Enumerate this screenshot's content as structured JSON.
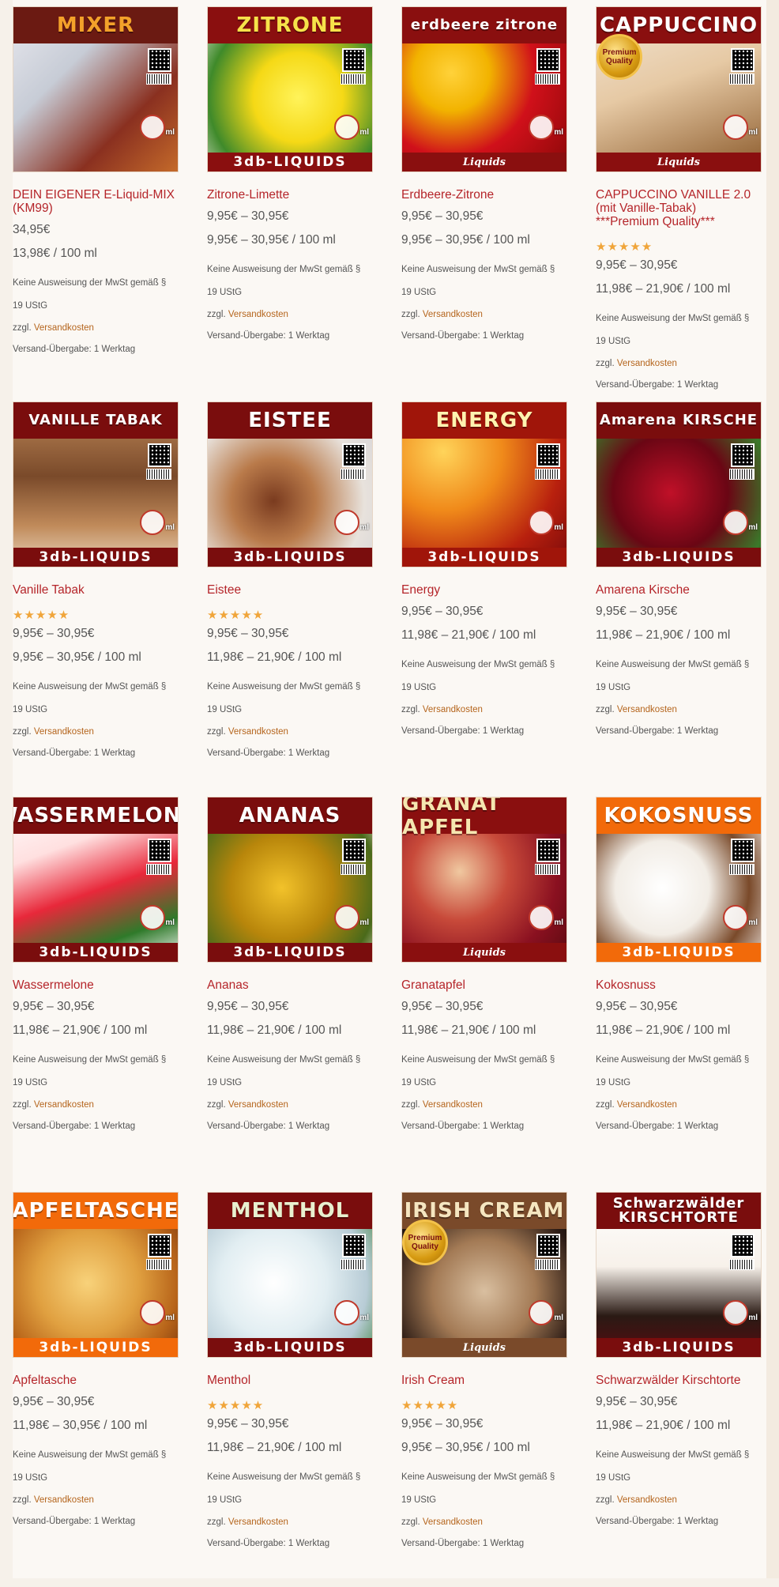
{
  "colors": {
    "accent": "#b5252a",
    "link": "#b5651d",
    "stars": "#f0a53a"
  },
  "labels": {
    "tax_note": "Keine Ausweisung der MwSt gemäß §",
    "tax_note_2": "19 UStG",
    "shipping_prefix": "zzgl.",
    "shipping_link": "Versandkosten",
    "delivery": "Versand-Übergabe: 1 Werktag",
    "brand": "3db-LIQUIDS",
    "ml": "ml"
  },
  "products": [
    {
      "name": "DEIN EIGENER E-Liquid-MIX (KM99)",
      "price": "34,95€",
      "unit_price": "13,98€ / 100 ml",
      "rating": 0,
      "rating_shown": false,
      "banner": "MIXER",
      "banner_color": "#6b1a12",
      "img": "linear-gradient(135deg,#e8e8ee 0%,#c7ccd6 35%,#8a3020 70%,#c46a2a 100%)",
      "banner_text_color": "#f3a12a",
      "bottom": "",
      "medal": ""
    },
    {
      "name": "Zitrone-Limette",
      "price": "9,95€ – 30,95€",
      "unit_price": "9,95€ – 30,95€ / 100 ml",
      "rating": 0,
      "rating_shown": false,
      "banner": "ZITRONE",
      "banner_color": "#8a0f0f",
      "img": "radial-gradient(circle at 55% 55%,#fff35a 0%,#f5d916 35%,#3f8a2a 70%,#e9e9e0 100%)",
      "banner_text_color": "#f6e24a",
      "bottom": "3db-LIQUIDS",
      "medal": ""
    },
    {
      "name": "Erdbeere-Zitrone",
      "price": "9,95€ – 30,95€",
      "unit_price": "9,95€ – 30,95€ / 100 ml",
      "rating": 0,
      "rating_shown": false,
      "banner": "erdbeere zitrone",
      "banner_color": "#8a0f0f",
      "img": "radial-gradient(circle at 30% 40%,#ffd23a 0%,#f2b300 25%,#d0101a 55%,#8a0808 100%)",
      "banner_text_color": "#ffffff",
      "bottom": "Liquids",
      "medal": ""
    },
    {
      "name": "CAPPUCCINO VANILLE 2.0 (mit Vanille-Tabak) ***Premium Quality***",
      "price": "9,95€ – 30,95€",
      "unit_price": "11,98€ – 21,90€ / 100 ml",
      "rating": 5,
      "rating_shown": true,
      "banner": "CAPPUCCINO",
      "banner_color": "#8a0f0f",
      "img": "linear-gradient(160deg,#f3e6d6 0%,#e6c9a4 45%,#8b5a2b 100%)",
      "banner_text_color": "#ffffff",
      "bottom": "Liquids",
      "medal": "Premium Quality"
    },
    {
      "name": "Vanille Tabak",
      "price": "9,95€ – 30,95€",
      "unit_price": "9,95€ – 30,95€ / 100 ml",
      "rating": 4.5,
      "rating_shown": true,
      "banner": "VANILLE TABAK",
      "banner_color": "#7a0d0d",
      "img": "linear-gradient(180deg,#c08a5a 0%,#7a4a2a 45%,#c08a5a 75%,#e8d4bc 100%)",
      "banner_text_color": "#ffffff",
      "bottom": "3db-LIQUIDS",
      "medal": ""
    },
    {
      "name": "Eistee",
      "price": "9,95€ – 30,95€",
      "unit_price": "11,98€ – 21,90€ / 100 ml",
      "rating": 5,
      "rating_shown": true,
      "banner": "EISTEE",
      "banner_color": "#7a0d0d",
      "img": "radial-gradient(circle at 40% 60%,#7a3b1f 0%,#b97a4a 30%,#e8e2dc 65%,#d0d0d6 100%)",
      "banner_text_color": "#ffffff",
      "bottom": "3db-LIQUIDS",
      "medal": ""
    },
    {
      "name": "Energy",
      "price": "9,95€ – 30,95€",
      "unit_price": "11,98€ – 21,90€ / 100 ml",
      "rating": 0,
      "rating_shown": false,
      "banner": "ENERGY",
      "banner_color": "#a0150a",
      "img": "radial-gradient(circle at 25% 30%,#ffd45a 0%,#f08a1a 35%,#b8200e 70%,#7a0a0a 100%)",
      "banner_text_color": "#fff3b0",
      "bottom": "3db-LIQUIDS",
      "medal": ""
    },
    {
      "name": "Amarena Kirsche",
      "price": "9,95€ – 30,95€",
      "unit_price": "11,98€ – 21,90€ / 100 ml",
      "rating": 0,
      "rating_shown": false,
      "banner": "Amarena KIRSCHE",
      "banner_color": "#7a0d0d",
      "img": "radial-gradient(circle at 45% 55%,#c01028 0%,#6a0614 45%,#3a7a2a 80%,#2a4a1a 100%)",
      "banner_text_color": "#ffffff",
      "bottom": "3db-LIQUIDS",
      "medal": ""
    },
    {
      "name": "Wassermelone",
      "price": "9,95€ – 30,95€",
      "unit_price": "11,98€ – 21,90€ / 100 ml",
      "rating": 0,
      "rating_shown": false,
      "banner": "WASSERMELONE",
      "banner_color": "#7a0d0d",
      "img": "linear-gradient(160deg,#ffffff 0%,#ffe0e0 30%,#e8283a 55%,#2f7a2a 80%,#ffffff 100%)",
      "banner_text_color": "#ffffff",
      "bottom": "3db-LIQUIDS",
      "medal": ""
    },
    {
      "name": "Ananas",
      "price": "9,95€ – 30,95€",
      "unit_price": "11,98€ – 21,90€ / 100 ml",
      "rating": 0,
      "rating_shown": false,
      "banner": "ANANAS",
      "banner_color": "#7a0d0d",
      "img": "radial-gradient(circle at 45% 55%,#f2c22a 0%,#b8860b 40%,#4a6a1a 75%,#f5f0e8 100%)",
      "banner_text_color": "#ffffff",
      "bottom": "3db-LIQUIDS",
      "medal": ""
    },
    {
      "name": "Granatapfel",
      "price": "9,95€ – 30,95€",
      "unit_price": "11,98€ – 21,90€ / 100 ml",
      "rating": 0,
      "rating_shown": false,
      "banner": "GRANAT APFEL",
      "banner_color": "#8a0f0f",
      "img": "radial-gradient(circle at 35% 45%,#f0c8a0 0%,#c84a3a 35%,#8a1020 70%,#5a0a10 100%)",
      "banner_text_color": "#f5e6b0",
      "bottom": "Liquids",
      "medal": ""
    },
    {
      "name": "Kokosnuss",
      "price": "9,95€ – 30,95€",
      "unit_price": "11,98€ – 21,90€ / 100 ml",
      "rating": 0,
      "rating_shown": false,
      "banner": "KOKOSNUSS",
      "banner_color": "#f26a0a",
      "img": "radial-gradient(circle at 40% 55%,#ffffff 0%,#f2ede6 35%,#7a4a2a 65%,#ffffff 100%)",
      "banner_text_color": "#ffffff",
      "bottom": "3db-LIQUIDS",
      "medal": ""
    },
    {
      "name": "Apfeltasche",
      "price": "9,95€ – 30,95€",
      "unit_price": "11,98€ – 30,95€ / 100 ml",
      "rating": 0,
      "rating_shown": false,
      "banner": "APFELTASCHE",
      "banner_color": "#f26a0a",
      "img": "radial-gradient(circle at 45% 55%,#f8d27a 0%,#e0a040 40%,#b8651a 70%,#6a2a0a 100%)",
      "banner_text_color": "#ffffff",
      "bottom": "3db-LIQUIDS",
      "medal": ""
    },
    {
      "name": "Menthol",
      "price": "9,95€ – 30,95€",
      "unit_price": "11,98€ – 21,90€ / 100 ml",
      "rating": 5,
      "rating_shown": true,
      "banner": "MENTHOL",
      "banner_color": "#7a0d0d",
      "img": "radial-gradient(circle at 40% 55%,#ffffff 0%,#e2eef2 40%,#b8ccd6 70%,#2f7a2a 100%)",
      "banner_text_color": "#e8f0d0",
      "bottom": "3db-LIQUIDS",
      "medal": ""
    },
    {
      "name": "Irish Cream",
      "price": "9,95€ – 30,95€",
      "unit_price": "9,95€ – 30,95€ / 100 ml",
      "rating": 5,
      "rating_shown": true,
      "banner": "IRISH CREAM",
      "banner_color": "#7a4a2a",
      "img": "radial-gradient(circle at 50% 60%,#d9bfa0 0%,#a37a55 40%,#2a1a14 75%,#000000 100%)",
      "banner_text_color": "#f5e6c0",
      "bottom": "Liquids",
      "medal": "Premium Quality"
    },
    {
      "name": "Schwarzwälder Kirschtorte",
      "price": "9,95€ – 30,95€",
      "unit_price": "11,98€ – 21,90€ / 100 ml",
      "rating": 0,
      "rating_shown": false,
      "banner": "Schwarzwälder KIRSCHTORTE",
      "banner_color": "#7a0d0d",
      "img": "linear-gradient(180deg,#ffffff 0%,#f7f1ea 45%,#2a1a14 75%,#5a0a10 100%)",
      "banner_text_color": "#ffffff",
      "bottom": "3db-LIQUIDS",
      "medal": ""
    }
  ]
}
